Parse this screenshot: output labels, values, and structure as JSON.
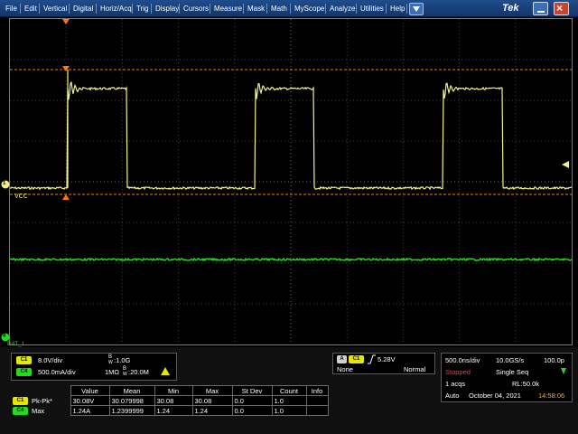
{
  "menu": {
    "items": [
      "File",
      "Edit",
      "Vertical",
      "Digital",
      "Horiz/Acq",
      "Trig",
      "Display",
      "Cursors",
      "Measure",
      "Mask",
      "Math",
      "MyScope",
      "Analyze",
      "Utilities",
      "Help"
    ],
    "brand": "Tek"
  },
  "waveform": {
    "ch1_marker": "1",
    "ch1_label": "VCC",
    "ch4_marker": "4",
    "ch4_label": "BAT_1",
    "ch1_color": "#f2f28a",
    "ch4_color": "#27d821",
    "cursor_color": "#ff7a00"
  },
  "channels": {
    "c1_badge": "C1",
    "c1_scale": "8.0V/div",
    "c1_bw_symbol": "B",
    "c1_bw_sub": "W",
    "c1_bw": ":1.0G",
    "c4_badge": "C4",
    "c4_scale": "500.0mA/div",
    "c4_impedance": "1MΩ",
    "c4_bw_symbol": "B",
    "c4_bw_sub": "W",
    "c4_bw": ":20.0M"
  },
  "trigger": {
    "badge_a": "A",
    "badge_ch": "C1",
    "level": "5.28V",
    "coupling": "None",
    "mode": "Normal"
  },
  "acquisition": {
    "time_div": "500.0ns/div",
    "sample_rate": "10.0GS/s",
    "sample_interval": "100.0p",
    "status": "Stopped",
    "seq_mode": "Single Seq",
    "acqs": "1 acqs",
    "record_length": "RL:50.0k",
    "run_mode": "Auto",
    "date": "October 04, 2021",
    "time": "14:58:06"
  },
  "measurements": {
    "headers": [
      "Value",
      "Mean",
      "Min",
      "Max",
      "St Dev",
      "Count",
      "Info"
    ],
    "rows": [
      {
        "badge": "C1",
        "name": "Pk-Pk*",
        "value": "30.08V",
        "mean": "30.079998",
        "min": "30.08",
        "max": "30.08",
        "stdev": "0.0",
        "count": "1.0",
        "info": ""
      },
      {
        "badge": "C4",
        "name": "Max",
        "value": "1.24A",
        "mean": "1.2399999",
        "min": "1.24",
        "max": "1.24",
        "stdev": "0.0",
        "count": "1.0",
        "info": ""
      }
    ]
  }
}
